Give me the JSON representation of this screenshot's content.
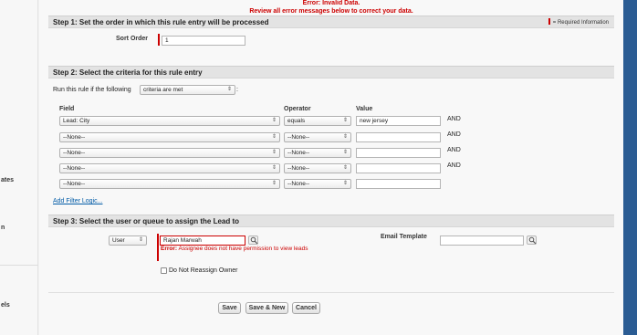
{
  "sidebar": {
    "fragments": [
      {
        "text": "ates"
      },
      {
        "text": "n"
      },
      {
        "text": "els"
      }
    ]
  },
  "error_banner": {
    "title": "Error: Invalid Data.",
    "message": "Review all error messages below to correct your data."
  },
  "step1": {
    "title": "Step 1: Set the order in which this rule entry will be processed",
    "required_note": "= Required Information",
    "sort_order_label": "Sort Order",
    "sort_order_value": "1"
  },
  "step2": {
    "title": "Step 2: Select the criteria for this rule entry",
    "run_prefix": "Run this rule if the following",
    "run_select": "criteria are met",
    "run_suffix": ":",
    "col_field": "Field",
    "col_operator": "Operator",
    "col_value": "Value",
    "rows": [
      {
        "field": "Lead: City",
        "operator": "equals",
        "value": "new jersey",
        "conj": "AND"
      },
      {
        "field": "--None--",
        "operator": "--None--",
        "value": "",
        "conj": "AND"
      },
      {
        "field": "--None--",
        "operator": "--None--",
        "value": "",
        "conj": "AND"
      },
      {
        "field": "--None--",
        "operator": "--None--",
        "value": "",
        "conj": "AND"
      },
      {
        "field": "--None--",
        "operator": "--None--",
        "value": "",
        "conj": ""
      }
    ],
    "filter_logic_link": "Add Filter Logic..."
  },
  "step3": {
    "title": "Step 3: Select the user or queue to assign the Lead to",
    "assignee_type": "User",
    "assignee_value": "Rajan Marwah",
    "error_label": "Error:",
    "error_message": "Assignee does not have permission to view leads",
    "do_not_reassign_label": "Do Not Reassign Owner",
    "do_not_reassign_checked": false,
    "email_template_label": "Email Template",
    "email_template_value": ""
  },
  "buttons": {
    "save": "Save",
    "save_new": "Save & New",
    "cancel": "Cancel"
  },
  "colors": {
    "error": "#cc0000",
    "required": "#cc0000",
    "link": "#015ba7",
    "step_bar": "#e3e3e3",
    "edge_blue": "#2b5c93"
  },
  "icons": {
    "lookup": "magnifier-lookup-icon",
    "select_arrow": "updown-arrows-icon"
  }
}
